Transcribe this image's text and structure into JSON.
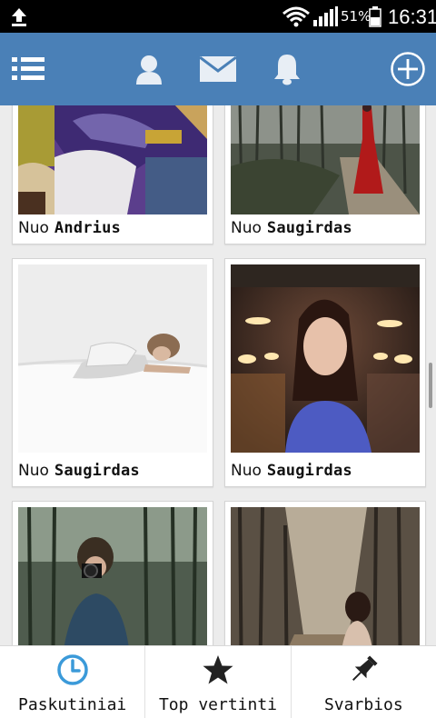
{
  "status_bar": {
    "battery_percent": "51%",
    "time": "16:31",
    "icons": [
      "upload-icon",
      "wifi-icon",
      "signal-icon",
      "battery-icon"
    ]
  },
  "action_bar": {
    "icons": [
      "menu-icon",
      "profile-icon",
      "mail-icon",
      "bell-icon",
      "add-icon"
    ],
    "color": "#4a80b7"
  },
  "feed": {
    "prefix": "Nuo",
    "cards": [
      {
        "author": "Andrius"
      },
      {
        "author": "Saugirdas"
      },
      {
        "author": "Saugirdas"
      },
      {
        "author": "Saugirdas"
      },
      {
        "author": ""
      },
      {
        "author": ""
      }
    ]
  },
  "tabs": [
    {
      "label": "Paskutiniai",
      "icon": "clock-icon",
      "active": true
    },
    {
      "label": "Top vertinti",
      "icon": "star-icon",
      "active": false
    },
    {
      "label": "Svarbios",
      "icon": "pin-icon",
      "active": false
    }
  ],
  "colors": {
    "accent": "#4a80b7",
    "clock": "#3b9ad9"
  }
}
